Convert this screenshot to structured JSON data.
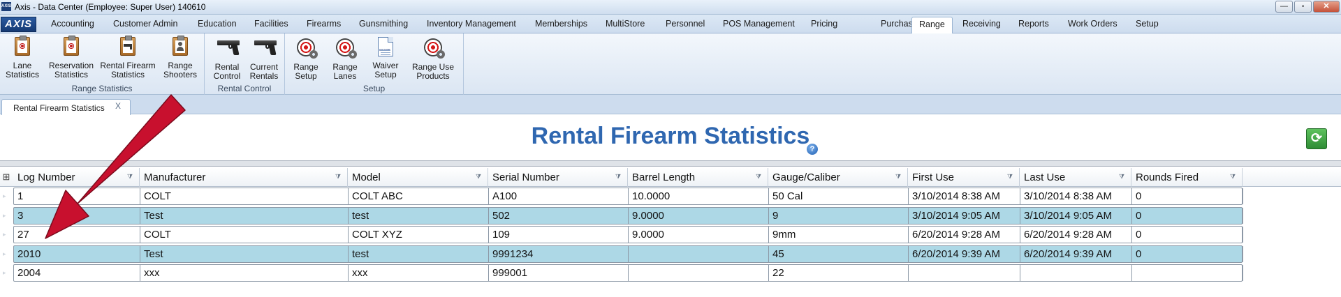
{
  "window": {
    "logo_text": "AXIS",
    "title": "Axis - Data Center  (Employee: Super User) 140610",
    "controls": {
      "minimize": "—",
      "maximize": "▫",
      "close": "✕"
    }
  },
  "menu": {
    "brand": "AXIS",
    "items": [
      "Accounting",
      "Customer Admin",
      "Education",
      "Facilities",
      "Firearms",
      "Gunsmithing",
      "Inventory Management",
      "Memberships",
      "MultiStore",
      "Personnel",
      "POS Management",
      "Pricing",
      "Purchasing",
      "Range",
      "Receiving",
      "Reports",
      "Work Orders",
      "Setup"
    ],
    "active": "Range"
  },
  "ribbon": {
    "groups": [
      {
        "label": "Range Statistics",
        "buttons": [
          {
            "line1": "Lane",
            "line2": "Statistics",
            "icon": "clipboard-target-icon"
          },
          {
            "line1": "Reservation",
            "line2": "Statistics",
            "icon": "clipboard-target-icon"
          },
          {
            "line1": "Rental Firearm",
            "line2": "Statistics",
            "icon": "clipboard-gun-icon"
          },
          {
            "line1": "Range",
            "line2": "Shooters",
            "icon": "clipboard-person-icon"
          }
        ]
      },
      {
        "label": "Rental Control",
        "buttons": [
          {
            "line1": "Rental",
            "line2": "Control",
            "icon": "pistol-icon"
          },
          {
            "line1": "Current",
            "line2": "Rentals",
            "icon": "pistol-icon"
          }
        ]
      },
      {
        "label": "Setup",
        "buttons": [
          {
            "line1": "Range",
            "line2": "Setup",
            "icon": "target-gear-icon"
          },
          {
            "line1": "Range",
            "line2": "Lanes",
            "icon": "target-gear-icon"
          },
          {
            "line1": "Waiver",
            "line2": "Setup",
            "icon": "waiver-document-icon"
          },
          {
            "line1": "Range Use",
            "line2": "Products",
            "icon": "target-gear-icon"
          }
        ]
      }
    ],
    "waiver_icon_text": "WAIVER"
  },
  "doc_tab": {
    "label": "Rental Firearm Statistics",
    "close": "X"
  },
  "page": {
    "title": "Rental Firearm Statistics",
    "help": "?",
    "refresh": "⟳"
  },
  "grid": {
    "corner_icon": "⊞",
    "columns": [
      "Log Number",
      "Manufacturer",
      "Model",
      "Serial Number",
      "Barrel Length",
      "Gauge/Caliber",
      "First Use",
      "Last Use",
      "Rounds Fired"
    ],
    "filter_icon": "⧩",
    "rows": [
      [
        "1",
        "COLT",
        "COLT ABC",
        "A100",
        "10.0000",
        "50 Cal",
        "3/10/2014 8:38 AM",
        "3/10/2014 8:38 AM",
        "0"
      ],
      [
        "3",
        "Test",
        "test",
        "502",
        "9.0000",
        "9",
        "3/10/2014 9:05 AM",
        "3/10/2014 9:05 AM",
        "0"
      ],
      [
        "27",
        "COLT",
        "COLT XYZ",
        "109",
        "9.0000",
        "9mm",
        "6/20/2014 9:28 AM",
        "6/20/2014 9:28 AM",
        "0"
      ],
      [
        "2010",
        "Test",
        "test",
        "9991234",
        "",
        "45",
        "6/20/2014 9:39 AM",
        "6/20/2014 9:39 AM",
        "0"
      ],
      [
        "2004",
        "xxx",
        "xxx",
        "999001",
        "",
        "22",
        "",
        "",
        ""
      ]
    ]
  },
  "colors": {
    "accent": "#2f67b0",
    "row_alt": "#add8e6",
    "arrow": "#c8102e",
    "refresh": "#2f8c35"
  }
}
